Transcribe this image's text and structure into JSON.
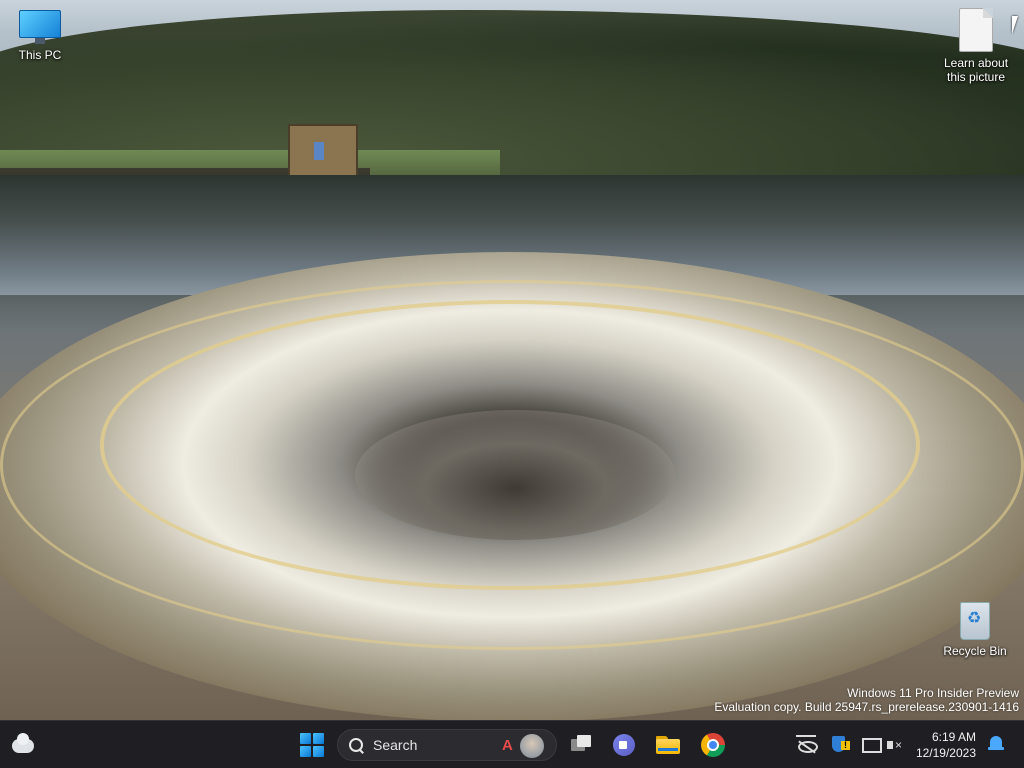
{
  "desktop": {
    "icons": [
      {
        "label": "This PC",
        "icon": "computer-icon"
      },
      {
        "label": "Learn about this picture",
        "icon": "document-icon"
      },
      {
        "label": "Recycle Bin",
        "icon": "recycle-bin-icon"
      }
    ],
    "watermark": {
      "line1": "Windows 11 Pro Insider Preview",
      "line2": "Evaluation copy. Build 25947.rs_prerelease.230901-1416"
    }
  },
  "taskbar": {
    "search_label": "Search",
    "apps": [
      "Start",
      "Search",
      "Task View",
      "Clipchamp",
      "File Explorer",
      "Google Chrome"
    ],
    "clock": {
      "time": "6:19 AM",
      "date": "12/19/2023"
    },
    "accent_color": "#0a78d4"
  }
}
